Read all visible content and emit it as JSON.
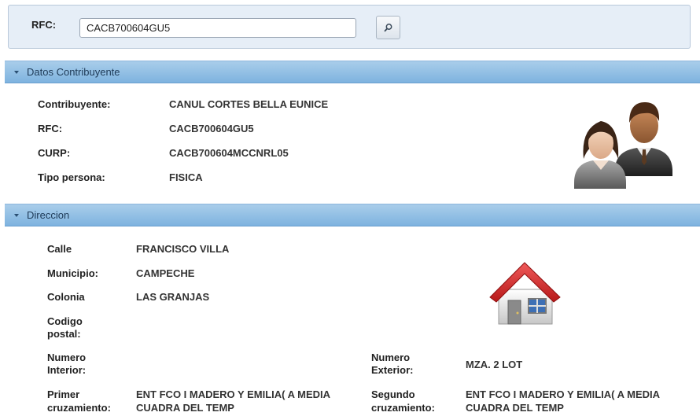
{
  "search": {
    "label": "RFC:",
    "value": "CACB700604GU5",
    "button_icon": "search-icon"
  },
  "contribuyente": {
    "section_title": "Datos Contribuyente",
    "fields": [
      {
        "label": "Contribuyente:",
        "value": "CANUL CORTES BELLA EUNICE"
      },
      {
        "label": "RFC:",
        "value": "CACB700604GU5"
      },
      {
        "label": "CURP:",
        "value": "CACB700604MCCNRL05"
      },
      {
        "label": "Tipo persona:",
        "value": "FISICA"
      }
    ],
    "icon": "people-icon"
  },
  "direccion": {
    "section_title": "Direccion",
    "calle": {
      "label": "Calle",
      "value": "FRANCISCO VILLA"
    },
    "municipio": {
      "label": "Municipio:",
      "value": "CAMPECHE"
    },
    "colonia": {
      "label": "Colonia",
      "value": "LAS GRANJAS"
    },
    "codigo_postal": {
      "label_1": "Codigo",
      "label_2": "postal:",
      "value": ""
    },
    "numero_interior": {
      "label_1": "Numero",
      "label_2": "Interior:",
      "value": ""
    },
    "numero_exterior": {
      "label_1": "Numero",
      "label_2": "Exterior:",
      "value": "MZA. 2 LOT"
    },
    "primer_cruzamiento": {
      "label_1": "Primer",
      "label_2": "cruzamiento:",
      "value_1": "ENT FCO I MADERO Y EMILIA( A MEDIA",
      "value_2": "CUADRA DEL TEMP"
    },
    "segundo_cruzamiento": {
      "label_1": "Segundo",
      "label_2": "cruzamiento:",
      "value_1": "ENT FCO I MADERO Y EMILIA( A MEDIA",
      "value_2": "CUADRA DEL TEMP"
    },
    "icon": "house-icon"
  },
  "colors": {
    "header_top": "#a9cdea",
    "header_bottom": "#7eb3df",
    "panel_bg": "#e6eef7"
  }
}
